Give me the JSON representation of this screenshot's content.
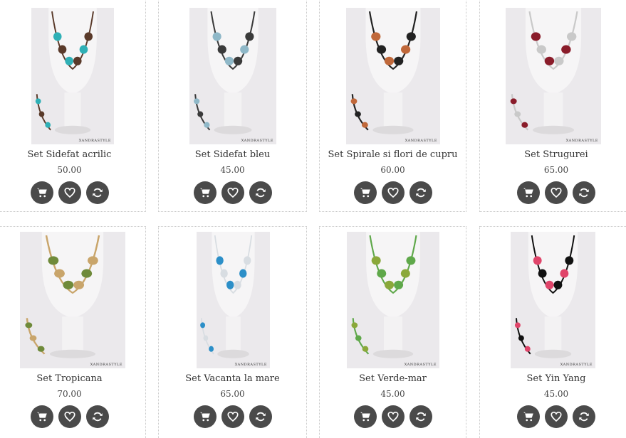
{
  "products": [
    {
      "title": "Set Sidefat acrilic",
      "price": "50.00",
      "brand": "XANDRASTYLE",
      "colors": [
        "#2fb0b6",
        "#5a3a2a"
      ]
    },
    {
      "title": "Set Sidefat bleu",
      "price": "45.00",
      "brand": "XANDRASTYLE",
      "colors": [
        "#8fb8c8",
        "#3a3a3a"
      ]
    },
    {
      "title": "Set Spirale si flori de cupru",
      "price": "60.00",
      "brand": "XANDRASTYLE",
      "colors": [
        "#c0683a",
        "#222222"
      ]
    },
    {
      "title": "Set Strugurei",
      "price": "65.00",
      "brand": "XANDRASTYLE",
      "colors": [
        "#8a1c2a",
        "#c9c9c9"
      ]
    },
    {
      "title": "Set Tropicana",
      "price": "70.00",
      "brand": "XANDRASTYLE",
      "colors": [
        "#6f8a3a",
        "#c9a56b"
      ]
    },
    {
      "title": "Set Vacanta la mare",
      "price": "65.00",
      "brand": "XANDRASTYLE",
      "colors": [
        "#2c8fc8",
        "#d8dde2"
      ]
    },
    {
      "title": "Set Verde-mar",
      "price": "45.00",
      "brand": "XANDRASTYLE",
      "colors": [
        "#8aa83a",
        "#5fa84a"
      ]
    },
    {
      "title": "Set Yin Yang",
      "price": "45.00",
      "brand": "XANDRASTYLE",
      "colors": [
        "#e0456a",
        "#111111"
      ]
    }
  ],
  "actions": {
    "cart_icon": "cart-icon",
    "wishlist_icon": "heart-icon",
    "compare_icon": "refresh-icon"
  }
}
